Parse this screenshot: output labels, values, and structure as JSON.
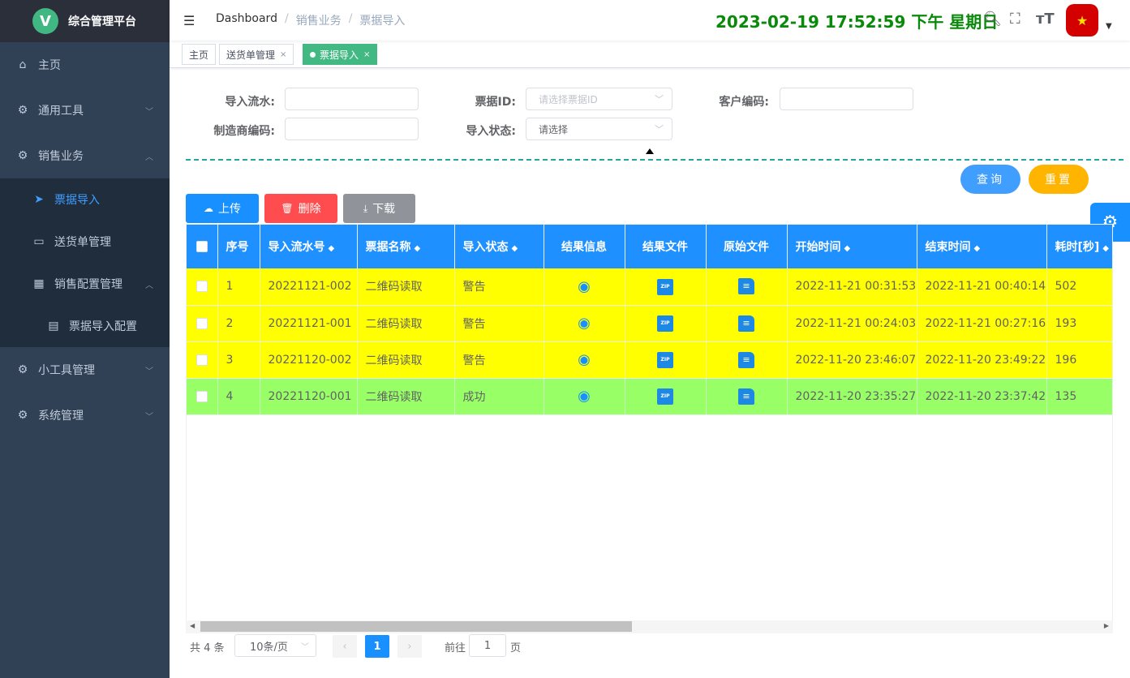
{
  "app": {
    "logo_letter": "V",
    "title": "综合管理平台"
  },
  "sidebar": {
    "items": [
      {
        "label": "主页",
        "icon": "home-icon"
      },
      {
        "label": "通用工具",
        "icon": "gear-icon"
      },
      {
        "label": "销售业务",
        "icon": "gear-icon"
      },
      {
        "label": "票据导入",
        "icon": "paper-plane-icon"
      },
      {
        "label": "送货单管理",
        "icon": "clipboard-icon"
      },
      {
        "label": "销售配置管理",
        "icon": "grid-icon"
      },
      {
        "label": "票据导入配置",
        "icon": "document-icon"
      },
      {
        "label": "小工具管理",
        "icon": "gear-icon"
      },
      {
        "label": "系统管理",
        "icon": "gear-icon"
      }
    ]
  },
  "header": {
    "breadcrumb": [
      "Dashboard",
      "销售业务",
      "票据导入"
    ],
    "clock": "2023-02-19 17:52:59 下午 星期日"
  },
  "tags": [
    {
      "label": "主页"
    },
    {
      "label": "送货单管理",
      "close": "×"
    },
    {
      "label": "票据导入",
      "close": "×"
    }
  ],
  "filters": {
    "serial_label": "导入流水:",
    "ticket_id_label": "票据ID:",
    "ticket_id_placeholder": "请选择票据ID",
    "customer_label": "客户编码:",
    "maker_label": "制造商编码:",
    "status_label": "导入状态:",
    "status_value": "请选择"
  },
  "actions": {
    "query": "查询",
    "reset": "重置"
  },
  "toolbar": {
    "upload": "上传",
    "delete": "删除",
    "download": "下载"
  },
  "table": {
    "headers": [
      "序号",
      "导入流水号",
      "票据名称",
      "导入状态",
      "结果信息",
      "结果文件",
      "原始文件",
      "开始时间",
      "结束时间",
      "耗时[秒]"
    ],
    "rows": [
      {
        "no": "1",
        "serial": "20221121-002",
        "name": "二维码读取",
        "status": "警告",
        "start": "2022-11-21 00:31:53",
        "end": "2022-11-21 00:40:14",
        "cost": "502",
        "bg": "#ffff00"
      },
      {
        "no": "2",
        "serial": "20221121-001",
        "name": "二维码读取",
        "status": "警告",
        "start": "2022-11-21 00:24:03",
        "end": "2022-11-21 00:27:16",
        "cost": "193",
        "bg": "#ffff00"
      },
      {
        "no": "3",
        "serial": "20221120-002",
        "name": "二维码读取",
        "status": "警告",
        "start": "2022-11-20 23:46:07",
        "end": "2022-11-20 23:49:22",
        "cost": "196",
        "bg": "#ffff00"
      },
      {
        "no": "4",
        "serial": "20221120-001",
        "name": "二维码读取",
        "status": "成功",
        "start": "2022-11-20 23:35:27",
        "end": "2022-11-20 23:37:42",
        "cost": "135",
        "bg": "#99ff66"
      }
    ]
  },
  "pagination": {
    "total": "共 4 条",
    "page_size": "10条/页",
    "current": "1",
    "goto": "前往",
    "goto_value": "1",
    "unit": "页"
  },
  "colors": {
    "sidebar": "#304156",
    "accent": "#1890ff",
    "warn_row": "#ffff00",
    "ok_row": "#99ff66",
    "clock": "#0a8a0a"
  }
}
